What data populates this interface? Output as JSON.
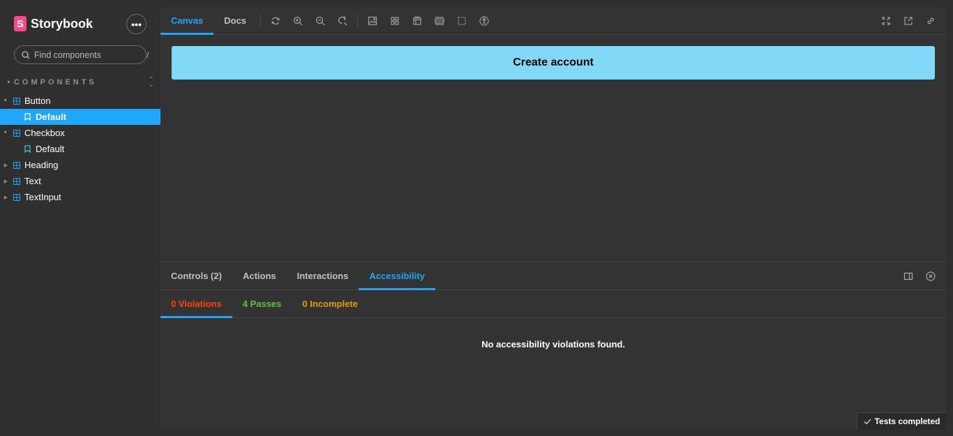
{
  "brand": {
    "logo_letter": "S",
    "name": "Storybook",
    "menu_label": "•••"
  },
  "search": {
    "placeholder": "Find components",
    "shortcut": "/"
  },
  "sidebar": {
    "section_title": "COMPONENTS",
    "items": [
      {
        "kind": "component",
        "label": "Button",
        "expanded": true
      },
      {
        "kind": "story",
        "label": "Default",
        "selected": true
      },
      {
        "kind": "component",
        "label": "Checkbox",
        "expanded": true
      },
      {
        "kind": "story",
        "label": "Default",
        "selected": false
      },
      {
        "kind": "component",
        "label": "Heading",
        "expanded": false
      },
      {
        "kind": "component",
        "label": "Text",
        "expanded": false
      },
      {
        "kind": "component",
        "label": "TextInput",
        "expanded": false
      }
    ]
  },
  "toolbar": {
    "tabs": [
      "Canvas",
      "Docs"
    ],
    "active_tab": "Canvas",
    "tool_icons": [
      "reload-icon",
      "zoom-in-icon",
      "zoom-out-icon",
      "zoom-reset-icon",
      "background-icon",
      "grid-icon",
      "viewport-icon",
      "measure-icon",
      "outline-icon",
      "accessibility-icon"
    ],
    "right_icons": [
      "fullscreen-icon",
      "open-new-tab-icon",
      "copy-link-icon"
    ]
  },
  "canvas": {
    "button_label": "Create account",
    "button_color": "#81d8f7"
  },
  "addons": {
    "tabs": [
      "Controls (2)",
      "Actions",
      "Interactions",
      "Accessibility"
    ],
    "active_tab": "Accessibility",
    "a11y": {
      "violations": "0 Violations",
      "passes": "4 Passes",
      "incomplete": "0 Incomplete",
      "message": "No accessibility violations found."
    }
  },
  "status": {
    "label": "Tests completed"
  },
  "colors": {
    "accent": "#1ea7fd",
    "brand": "#ff4785",
    "violations": "#ff4400",
    "passes": "#66bf3c",
    "incomplete": "#e69d00"
  }
}
